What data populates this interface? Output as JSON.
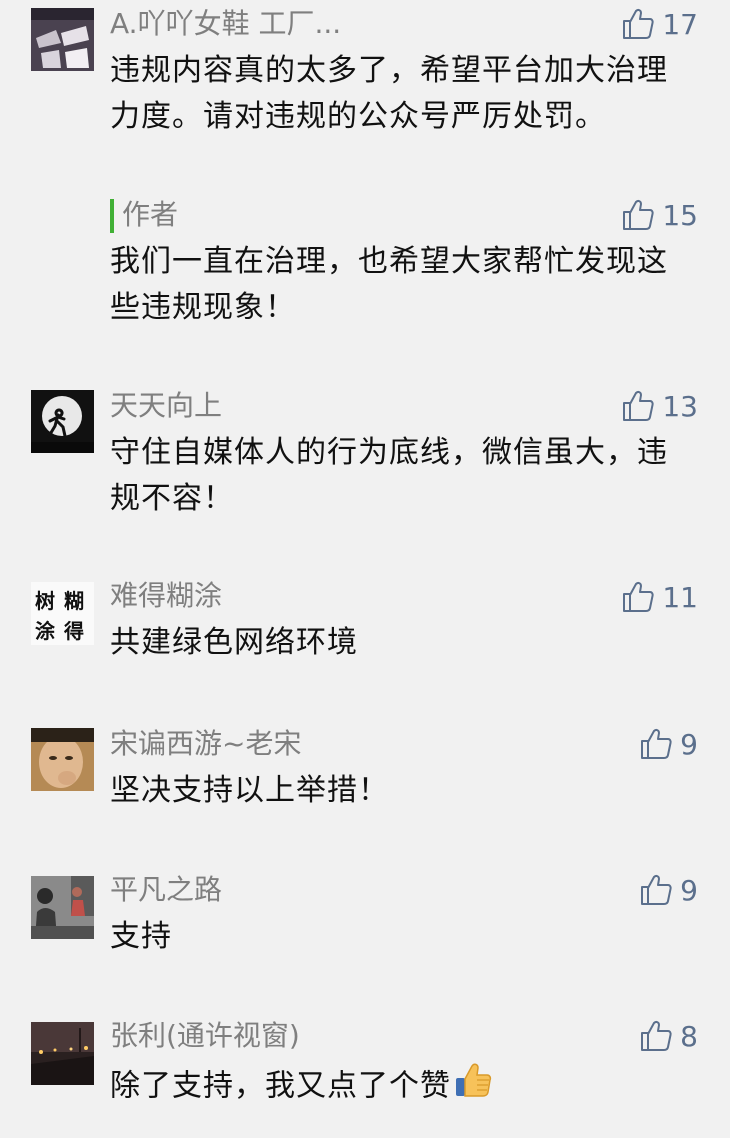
{
  "comments": [
    {
      "name": "A.吖吖女鞋 工厂...",
      "likes": "17",
      "text": "违规内容真的太多了，希望平台加大治理力度。请对违规的公众号严厉处罚。",
      "reply": {
        "label": "作者",
        "likes": "15",
        "text": "我们一直在治理，也希望大家帮忙发现这些违规现象！"
      }
    },
    {
      "name": "天天向上",
      "likes": "13",
      "text": "守住自媒体人的行为底线，微信虽大，违规不容！"
    },
    {
      "name": "难得糊涂",
      "likes": "11",
      "text": "共建绿色网络环境",
      "avatar_text": [
        "树",
        "糊",
        "涂",
        "得"
      ]
    },
    {
      "name": "宋谝西游~老宋",
      "likes": "9",
      "text": "坚决支持以上举措！"
    },
    {
      "name": "平凡之路",
      "likes": "9",
      "text": "支持"
    },
    {
      "name": "张利(通许视窗)",
      "likes": "8",
      "text": "除了支持，我又点了个赞"
    }
  ],
  "colors": {
    "background": "#f1f1f1",
    "name": "#7f7f7f",
    "like": "#5b6f8c",
    "author_bar": "#41b035"
  },
  "icons": {
    "like": "thumbs-up-icon",
    "emoji": "thumbs-up-emoji"
  }
}
